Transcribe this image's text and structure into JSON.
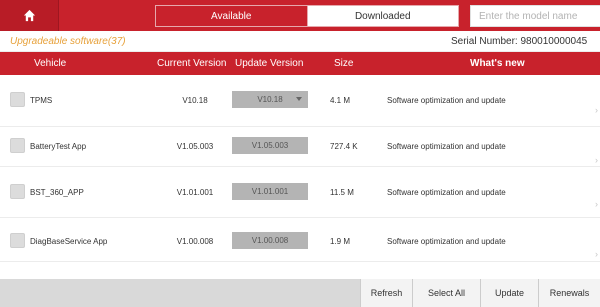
{
  "top_bar": {
    "tabs": {
      "available": "Available",
      "downloaded": "Downloaded"
    },
    "search_placeholder": "Enter the model name"
  },
  "info": {
    "upgradeable_label": "Upgradeable software(37)",
    "serial_number": "Serial Number:  980010000045"
  },
  "table": {
    "headers": {
      "vehicle": "Vehicle",
      "current_version": "Current Version",
      "update_version": "Update Version",
      "size": "Size",
      "whats_new": "What's new"
    },
    "rows": [
      {
        "vehicle": "TPMS",
        "current_version": "V10.18",
        "update_version": "V10.18",
        "has_dropdown": true,
        "size": "4.1 M",
        "whats_new": "Software optimization and update"
      },
      {
        "vehicle": "BatteryTest App",
        "current_version": "V1.05.003",
        "update_version": "V1.05.003",
        "has_dropdown": false,
        "size": "727.4 K",
        "whats_new": "Software optimization and update"
      },
      {
        "vehicle": "BST_360_APP",
        "current_version": "V1.01.001",
        "update_version": "V1.01.001",
        "has_dropdown": false,
        "size": "11.5 M",
        "whats_new": "Software optimization and update"
      },
      {
        "vehicle": "DiagBaseService App",
        "current_version": "V1.00.008",
        "update_version": "V1.00.008",
        "has_dropdown": false,
        "size": "1.9 M",
        "whats_new": "Software optimization and update"
      }
    ]
  },
  "footer": {
    "refresh": "Refresh",
    "select_all": "Select All",
    "update": "Update",
    "renewals": "Renewals"
  },
  "colors": {
    "brand_red": "#c8222c",
    "upgradeable_orange": "#e7a13a"
  },
  "icons": {
    "home": "home-icon",
    "dropdown": "chevron-down-icon",
    "row_more": "chevron-right-icon"
  }
}
